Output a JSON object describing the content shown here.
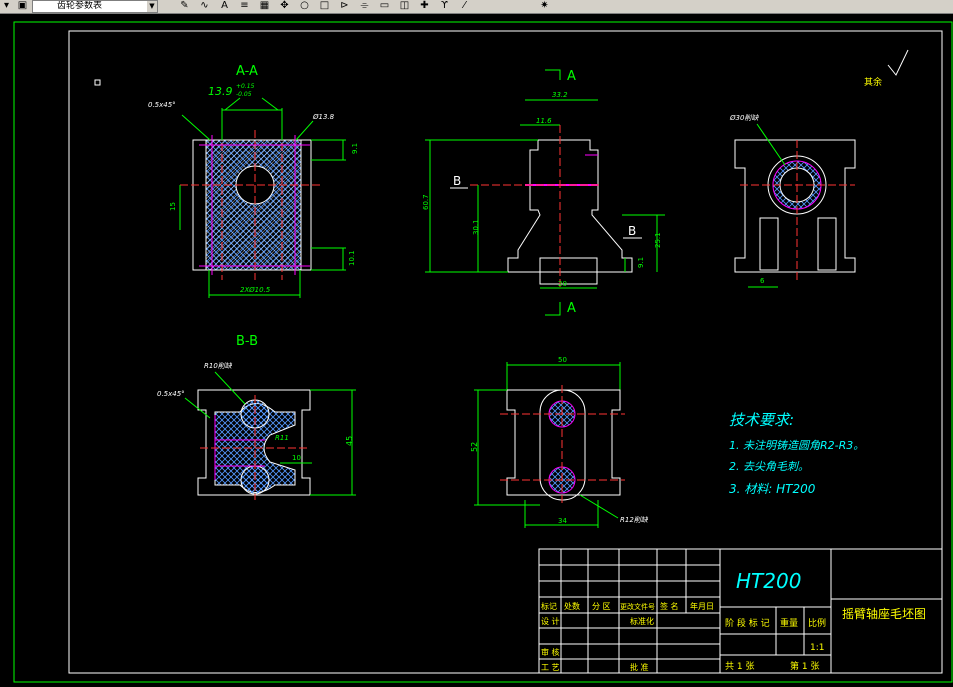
{
  "toolbar": {
    "combo_value": "齿轮参数表",
    "left_arrow_icon": "chevron-down-icon",
    "tools": [
      "pencil-icon",
      "curve-icon",
      "text-a-icon",
      "layers-icon",
      "grid-icon",
      "move-icon",
      "circle-icon",
      "box-icon",
      "mirror-icon",
      "offset-icon",
      "rect-icon",
      "square-icon",
      "cross-arrow-icon",
      "lamp-icon",
      "pin-icon",
      "explode-icon"
    ]
  },
  "drawing": {
    "section_aa_label": "A-A",
    "section_bb_label": "B-B",
    "view_a_top": "A",
    "view_a_bottom": "A",
    "view_b_left": "B",
    "view_b_right": "B",
    "roughness_note": "其余",
    "dims": {
      "chamfer_top": "0.5x45°",
      "tol_main": "13.9",
      "tol_upper": "+0.15",
      "tol_lower": "-0.05",
      "dia_138": "Ø13.8",
      "d_15": "15",
      "d_91": "9.1",
      "d_101": "10.1",
      "d_2phi105": "2XØ10.5",
      "d_332": "33.2",
      "d_116": "11.6",
      "d_607": "60.7",
      "d_301": "30.1",
      "d_251": "25.1",
      "d_91b": "9.1",
      "d_20": "20",
      "d_phi30": "Ø30削缺",
      "d_6": "6",
      "r10": "R10削缺",
      "chamfer_bb": "0.5x45°",
      "r11": "R11",
      "d_10": "10",
      "d_45": "45",
      "d_50": "50",
      "d_52": "52",
      "d_34": "34",
      "r12": "R12削缺"
    },
    "tech_req": {
      "title": "技术要求:",
      "items": [
        "1.  未注明铸造圆角R2-R3。",
        "2. 去尖角毛刺。",
        "3. 材料: HT200"
      ]
    },
    "title_block": {
      "material": "HT200",
      "part_name": "摇臂轴座毛坯图",
      "row_labels": [
        "标记",
        "处数",
        "分 区",
        "更改文件号",
        "签 名",
        "年月日"
      ],
      "design": "设 计",
      "standard": "标准化",
      "review": "审 核",
      "process": "工 艺",
      "approve": "批 准",
      "stage_label": "阶 段 标 记",
      "weight": "重量",
      "scale_label": "比例",
      "scale_value": "1:1",
      "total": "共 1 张",
      "sheet": "第 1 张"
    }
  },
  "colors": {
    "background": "#000000",
    "outline": "#ffffff",
    "dimension": "#00ff00",
    "centerline": "#ff0000",
    "hatch": "#4488ff",
    "magenta": "#ff00ff",
    "text_cyan": "#00ffff",
    "text_yellow": "#ffff00"
  }
}
